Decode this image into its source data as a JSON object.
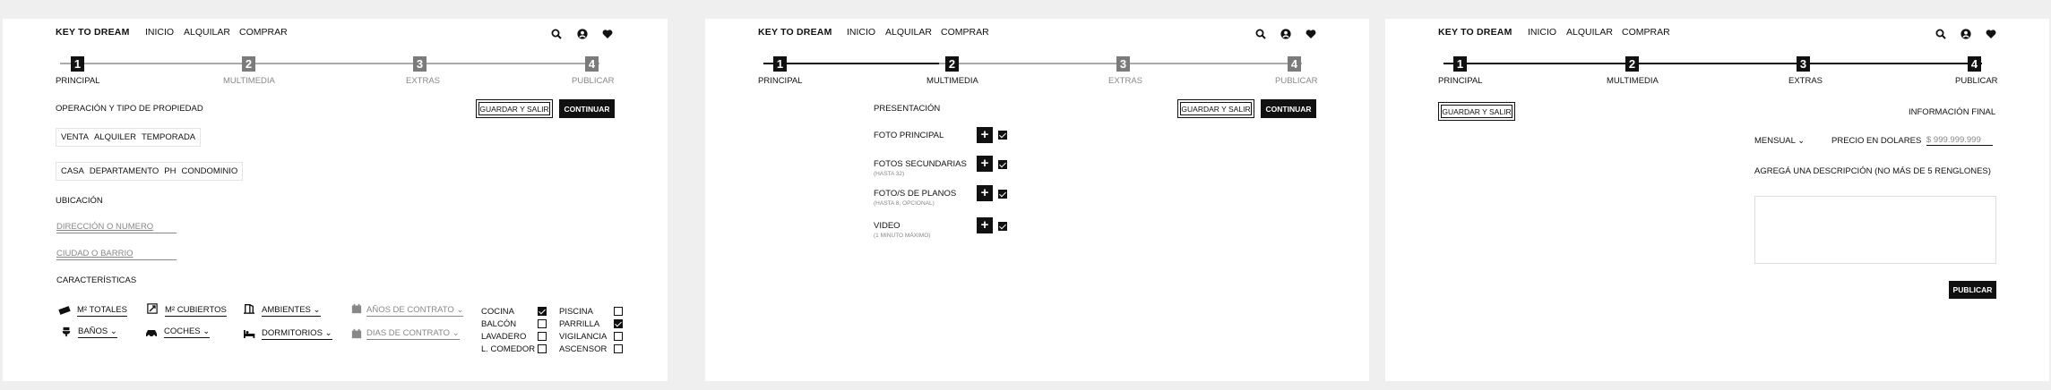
{
  "brand": "KEY TO DREAM",
  "nav": [
    "INICIO",
    "ALQUILAR",
    "COMPRAR"
  ],
  "icons": {
    "search": "search-icon",
    "user": "user-circle-icon",
    "favorites": "heart-icon"
  },
  "steps": [
    {
      "num": "1",
      "label": "PRINCIPAL"
    },
    {
      "num": "2",
      "label": "MULTIMEDIA"
    },
    {
      "num": "3",
      "label": "EXTRAS"
    },
    {
      "num": "4",
      "label": "PUBLICAR"
    }
  ],
  "buttons": {
    "save_exit": "GUARDAR Y SALIR",
    "continue": "CONTINUAR",
    "publish": "PUBLICAR"
  },
  "principal": {
    "operation_title": "OPERACIÓN Y TIPO DE PROPIEDAD",
    "operations": [
      "VENTA",
      "ALQUILER",
      "TEMPORADA"
    ],
    "property_types": [
      "CASA",
      "DEPARTAMENTO",
      "PH",
      "CONDOMINIO"
    ],
    "location_title": "UBICACIÓN",
    "address_placeholder": "DIRECCIÓN O NUMERO",
    "city_placeholder": "CIUDAD O BARRIO",
    "features_title": "CARACTERÍSTICAS",
    "fields": {
      "m2_total": "M² TOTALES",
      "m2_covered": "M² CUBIERTOS",
      "rooms": "AMBIENTES",
      "contract_years": "AÑOS DE CONTRATO",
      "bathrooms": "BAÑOS",
      "cars": "COCHES",
      "bedrooms": "DORMITORIOS",
      "contract_days": "DIAS DE CONTRATO"
    },
    "amenities": [
      {
        "label": "COCINA",
        "checked": true
      },
      {
        "label": "BALCÓN",
        "checked": false
      },
      {
        "label": "LAVADERO",
        "checked": false
      },
      {
        "label": "L. COMEDOR",
        "checked": false
      },
      {
        "label": "PISCINA",
        "checked": false
      },
      {
        "label": "PARRILLA",
        "checked": true
      },
      {
        "label": "VIGILANCIA",
        "checked": false
      },
      {
        "label": "ASCENSOR",
        "checked": false
      }
    ]
  },
  "multimedia": {
    "title": "PRESENTACIÓN",
    "items": [
      {
        "label": "FOTO PRINCIPAL",
        "sub": "",
        "checked": true
      },
      {
        "label": "FOTOS SECUNDARIAS",
        "sub": "(HASTA 32)",
        "checked": true
      },
      {
        "label": "FOTO/S DE PLANOS",
        "sub": "(HASTA 8, OPCIONAL)",
        "checked": true
      },
      {
        "label": "VIDEO",
        "sub": "(1 MINUTO MÁXIMO)",
        "checked": true
      }
    ]
  },
  "publicar": {
    "title": "INFORMACIÓN FINAL",
    "period": "MENSUAL",
    "price_label": "PRECIO EN DOLARES",
    "price_placeholder": "$ 999.999.999",
    "description_label": "AGREGÁ UNA DESCRIPCIÓN (NO MÁS DE 5 RENGLONES)"
  }
}
